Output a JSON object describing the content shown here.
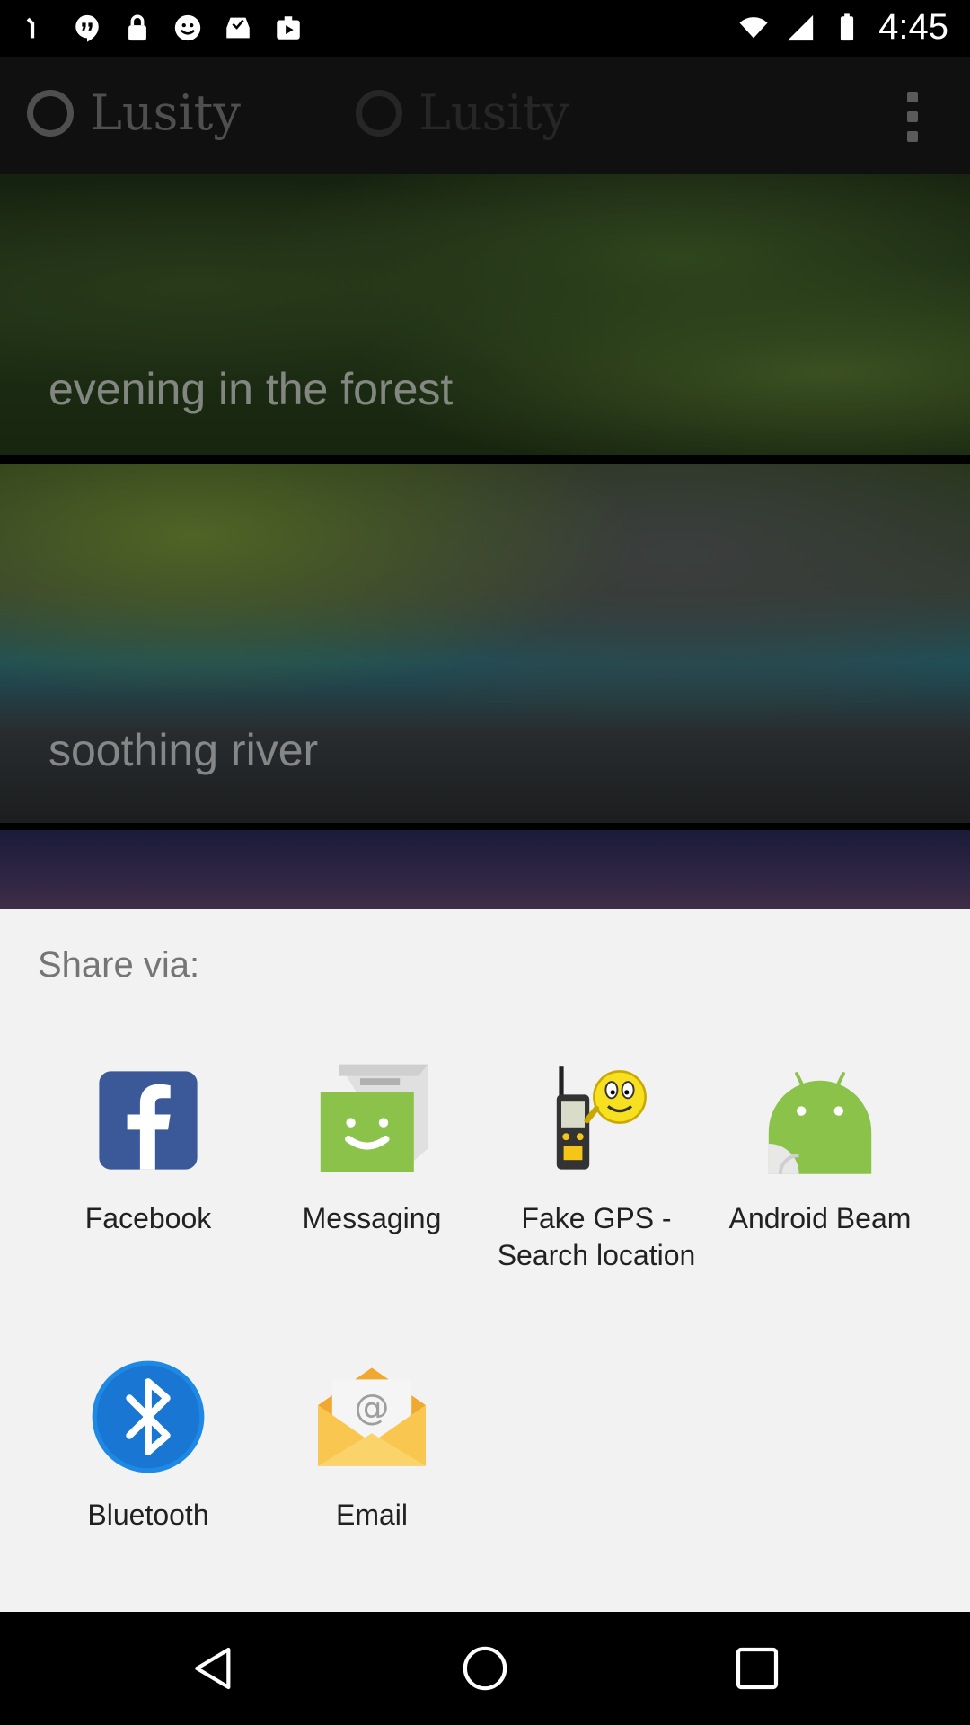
{
  "status_bar": {
    "time": "4:45",
    "notification_icons": [
      "signal-alt-icon",
      "hangouts-icon",
      "lock-icon",
      "emoji-icon",
      "inbox-icon",
      "play-store-icon"
    ]
  },
  "background_app": {
    "logo_text": "Lusity",
    "logo_text_shadow": "Lusity",
    "cards": [
      {
        "title": "evening in the forest"
      },
      {
        "title": "soothing river"
      }
    ]
  },
  "share_sheet": {
    "heading": "Share via:",
    "apps": [
      {
        "label": "Facebook",
        "icon": "facebook-icon",
        "color": "#3b5998"
      },
      {
        "label": "Messaging",
        "icon": "messaging-icon",
        "color": "#8bc34a"
      },
      {
        "label": "Fake GPS -\nSearch location",
        "icon": "fake-gps-icon",
        "color": "#f5d922"
      },
      {
        "label": "Android Beam",
        "icon": "android-beam-icon",
        "color": "#8bc34a"
      },
      {
        "label": "Bluetooth",
        "icon": "bluetooth-icon",
        "color": "#1e88e5"
      },
      {
        "label": "Email",
        "icon": "email-icon",
        "color": "#f9c74f"
      }
    ]
  },
  "nav_bar": {
    "buttons": [
      "back-icon",
      "home-icon",
      "recents-icon"
    ]
  }
}
